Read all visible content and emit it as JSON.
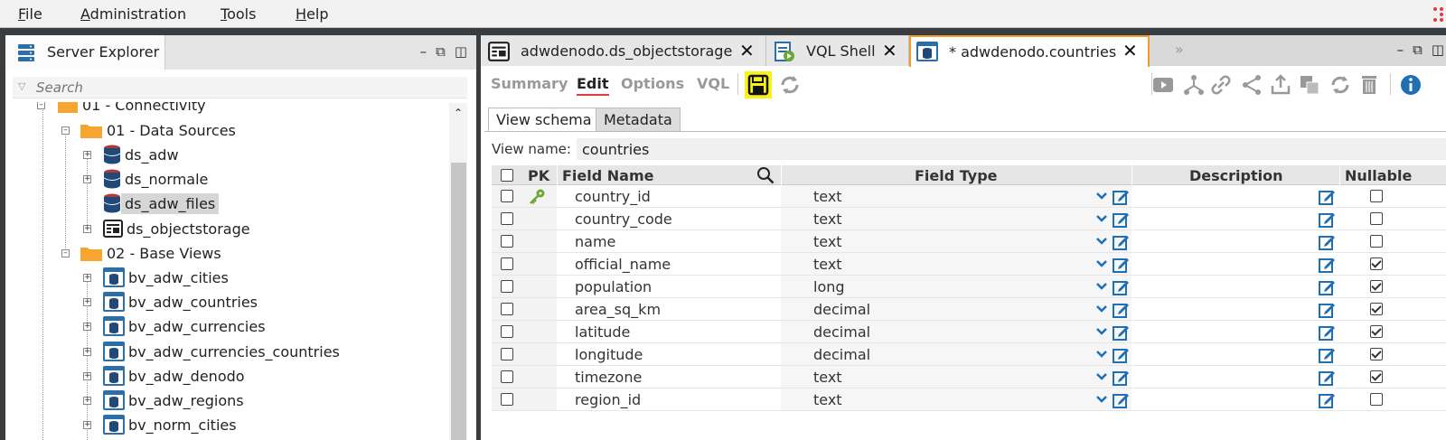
{
  "menu": {
    "items": [
      {
        "label": "File",
        "accel": "F",
        "rest": "ile"
      },
      {
        "label": "Administration",
        "accel": "A",
        "rest": "dministration"
      },
      {
        "label": "Tools",
        "accel": "T",
        "rest": "ools"
      },
      {
        "label": "Help",
        "accel": "H",
        "rest": "elp"
      }
    ]
  },
  "explorer": {
    "title": "Server Explorer",
    "search_placeholder": "Search",
    "tree": [
      {
        "label": "01 - Connectivity",
        "icon": "folder-icon"
      },
      {
        "label": "01 - Data Sources",
        "icon": "folder-icon"
      },
      {
        "label": "ds_adw",
        "icon": "database-icon"
      },
      {
        "label": "ds_normale",
        "icon": "database-icon"
      },
      {
        "label": "ds_adw_files",
        "icon": "database-icon",
        "selected": true
      },
      {
        "label": "ds_objectstorage",
        "icon": "object-storage-icon"
      },
      {
        "label": "02 - Base Views",
        "icon": "folder-icon"
      },
      {
        "label": "bv_adw_cities",
        "icon": "base-view-icon"
      },
      {
        "label": "bv_adw_countries",
        "icon": "base-view-icon"
      },
      {
        "label": "bv_adw_currencies",
        "icon": "base-view-icon"
      },
      {
        "label": "bv_adw_currencies_countries",
        "icon": "base-view-icon"
      },
      {
        "label": "bv_adw_denodo",
        "icon": "base-view-icon"
      },
      {
        "label": "bv_adw_regions",
        "icon": "base-view-icon"
      },
      {
        "label": "bv_norm_cities",
        "icon": "base-view-icon"
      }
    ]
  },
  "tabs": [
    {
      "label": "adwdenodo.ds_objectstorage",
      "icon": "object-storage-icon"
    },
    {
      "label": "VQL Shell",
      "icon": "vql-shell-icon"
    },
    {
      "label": "* adwdenodo.countries",
      "icon": "base-view-icon",
      "active": true
    }
  ],
  "subtabs": [
    "Summary",
    "Edit",
    "Options",
    "VQL"
  ],
  "active_subtab": "Edit",
  "view_tabs": [
    "View schema",
    "Metadata"
  ],
  "view_name_label": "View name:",
  "view_name": "countries",
  "grid": {
    "headers": {
      "pk": "PK",
      "field_name": "Field Name",
      "field_type": "Field Type",
      "description": "Description",
      "nullable": "Nullable"
    },
    "rows": [
      {
        "name": "country_id",
        "type": "text",
        "pk": true,
        "nullable": false
      },
      {
        "name": "country_code",
        "type": "text",
        "pk": false,
        "nullable": false
      },
      {
        "name": "name",
        "type": "text",
        "pk": false,
        "nullable": false
      },
      {
        "name": "official_name",
        "type": "text",
        "pk": false,
        "nullable": true
      },
      {
        "name": "population",
        "type": "long",
        "pk": false,
        "nullable": true
      },
      {
        "name": "area_sq_km",
        "type": "decimal",
        "pk": false,
        "nullable": true
      },
      {
        "name": "latitude",
        "type": "decimal",
        "pk": false,
        "nullable": true
      },
      {
        "name": "longitude",
        "type": "decimal",
        "pk": false,
        "nullable": true
      },
      {
        "name": "timezone",
        "type": "text",
        "pk": false,
        "nullable": true
      },
      {
        "name": "region_id",
        "type": "text",
        "pk": false,
        "nullable": false
      }
    ]
  },
  "colors": {
    "accent_orange": "#f39c2d",
    "edit_blue": "#1f6fb5",
    "save_yellow": "#f8f21b",
    "key_green": "#6aa832",
    "db_red": "#b03a3a"
  }
}
